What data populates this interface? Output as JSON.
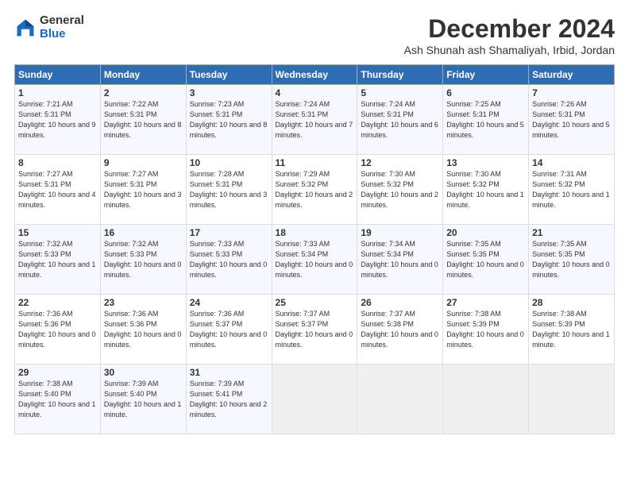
{
  "logo": {
    "general": "General",
    "blue": "Blue"
  },
  "title": "December 2024",
  "location": "Ash Shunah ash Shamaliyah, Irbid, Jordan",
  "headers": [
    "Sunday",
    "Monday",
    "Tuesday",
    "Wednesday",
    "Thursday",
    "Friday",
    "Saturday"
  ],
  "weeks": [
    [
      {
        "day": "1",
        "sunrise": "7:21 AM",
        "sunset": "5:31 PM",
        "daylight": "10 hours and 9 minutes."
      },
      {
        "day": "2",
        "sunrise": "7:22 AM",
        "sunset": "5:31 PM",
        "daylight": "10 hours and 8 minutes."
      },
      {
        "day": "3",
        "sunrise": "7:23 AM",
        "sunset": "5:31 PM",
        "daylight": "10 hours and 8 minutes."
      },
      {
        "day": "4",
        "sunrise": "7:24 AM",
        "sunset": "5:31 PM",
        "daylight": "10 hours and 7 minutes."
      },
      {
        "day": "5",
        "sunrise": "7:24 AM",
        "sunset": "5:31 PM",
        "daylight": "10 hours and 6 minutes."
      },
      {
        "day": "6",
        "sunrise": "7:25 AM",
        "sunset": "5:31 PM",
        "daylight": "10 hours and 5 minutes."
      },
      {
        "day": "7",
        "sunrise": "7:26 AM",
        "sunset": "5:31 PM",
        "daylight": "10 hours and 5 minutes."
      }
    ],
    [
      {
        "day": "8",
        "sunrise": "7:27 AM",
        "sunset": "5:31 PM",
        "daylight": "10 hours and 4 minutes."
      },
      {
        "day": "9",
        "sunrise": "7:27 AM",
        "sunset": "5:31 PM",
        "daylight": "10 hours and 3 minutes."
      },
      {
        "day": "10",
        "sunrise": "7:28 AM",
        "sunset": "5:31 PM",
        "daylight": "10 hours and 3 minutes."
      },
      {
        "day": "11",
        "sunrise": "7:29 AM",
        "sunset": "5:32 PM",
        "daylight": "10 hours and 2 minutes."
      },
      {
        "day": "12",
        "sunrise": "7:30 AM",
        "sunset": "5:32 PM",
        "daylight": "10 hours and 2 minutes."
      },
      {
        "day": "13",
        "sunrise": "7:30 AM",
        "sunset": "5:32 PM",
        "daylight": "10 hours and 1 minute."
      },
      {
        "day": "14",
        "sunrise": "7:31 AM",
        "sunset": "5:32 PM",
        "daylight": "10 hours and 1 minute."
      }
    ],
    [
      {
        "day": "15",
        "sunrise": "7:32 AM",
        "sunset": "5:33 PM",
        "daylight": "10 hours and 1 minute."
      },
      {
        "day": "16",
        "sunrise": "7:32 AM",
        "sunset": "5:33 PM",
        "daylight": "10 hours and 0 minutes."
      },
      {
        "day": "17",
        "sunrise": "7:33 AM",
        "sunset": "5:33 PM",
        "daylight": "10 hours and 0 minutes."
      },
      {
        "day": "18",
        "sunrise": "7:33 AM",
        "sunset": "5:34 PM",
        "daylight": "10 hours and 0 minutes."
      },
      {
        "day": "19",
        "sunrise": "7:34 AM",
        "sunset": "5:34 PM",
        "daylight": "10 hours and 0 minutes."
      },
      {
        "day": "20",
        "sunrise": "7:35 AM",
        "sunset": "5:35 PM",
        "daylight": "10 hours and 0 minutes."
      },
      {
        "day": "21",
        "sunrise": "7:35 AM",
        "sunset": "5:35 PM",
        "daylight": "10 hours and 0 minutes."
      }
    ],
    [
      {
        "day": "22",
        "sunrise": "7:36 AM",
        "sunset": "5:36 PM",
        "daylight": "10 hours and 0 minutes."
      },
      {
        "day": "23",
        "sunrise": "7:36 AM",
        "sunset": "5:36 PM",
        "daylight": "10 hours and 0 minutes."
      },
      {
        "day": "24",
        "sunrise": "7:36 AM",
        "sunset": "5:37 PM",
        "daylight": "10 hours and 0 minutes."
      },
      {
        "day": "25",
        "sunrise": "7:37 AM",
        "sunset": "5:37 PM",
        "daylight": "10 hours and 0 minutes."
      },
      {
        "day": "26",
        "sunrise": "7:37 AM",
        "sunset": "5:38 PM",
        "daylight": "10 hours and 0 minutes."
      },
      {
        "day": "27",
        "sunrise": "7:38 AM",
        "sunset": "5:39 PM",
        "daylight": "10 hours and 0 minutes."
      },
      {
        "day": "28",
        "sunrise": "7:38 AM",
        "sunset": "5:39 PM",
        "daylight": "10 hours and 1 minute."
      }
    ],
    [
      {
        "day": "29",
        "sunrise": "7:38 AM",
        "sunset": "5:40 PM",
        "daylight": "10 hours and 1 minute."
      },
      {
        "day": "30",
        "sunrise": "7:39 AM",
        "sunset": "5:40 PM",
        "daylight": "10 hours and 1 minute."
      },
      {
        "day": "31",
        "sunrise": "7:39 AM",
        "sunset": "5:41 PM",
        "daylight": "10 hours and 2 minutes."
      },
      null,
      null,
      null,
      null
    ]
  ]
}
